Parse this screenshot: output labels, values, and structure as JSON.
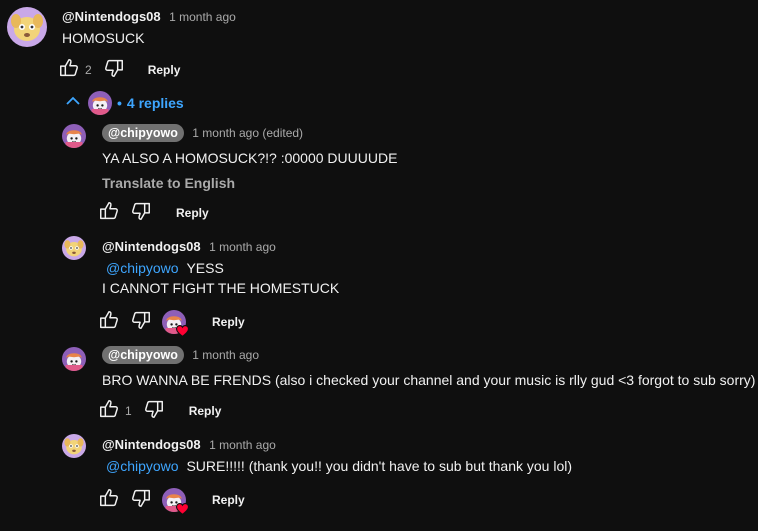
{
  "comment": {
    "author": "@Nintendogs08",
    "time": "1 month ago",
    "text": "HOMOSUCK",
    "likes": "2",
    "reply_label": "Reply"
  },
  "replies_toggle": {
    "dot": "•",
    "label": "4 replies"
  },
  "replies": [
    {
      "author": "@chipyowo",
      "time": "1 month ago (edited)",
      "text": "YA ALSO A HOMOSUCK?!? :00000 DUUUUDE",
      "translate": "Translate to English",
      "reply_label": "Reply"
    },
    {
      "author": "@Nintendogs08",
      "time": "1 month ago",
      "mention": "@chipyowo",
      "text_line1": "YESS",
      "text_line2": "I CANNOT FIGHT THE HOMESTUCK",
      "reply_label": "Reply"
    },
    {
      "author": "@chipyowo",
      "time": "1 month ago",
      "text": "BRO WANNA BE FRENDS (also i checked your channel and your music is rlly gud <3 forgot to sub sorry)",
      "likes": "1",
      "reply_label": "Reply"
    },
    {
      "author": "@Nintendogs08",
      "time": "1 month ago",
      "mention": "@chipyowo",
      "text": "SURE!!!!! (thank you!! you didn't have to sub but thank you lol)",
      "reply_label": "Reply"
    }
  ],
  "icons": {
    "like": "thumbs-up-icon",
    "dislike": "thumbs-down-icon",
    "collapse": "chevron-up-icon",
    "creator_heart": "heart-icon"
  },
  "colors": {
    "background": "#0f0f0f",
    "link": "#3ea6ff",
    "secondary_text": "#aaaaaa",
    "pill": "#717171",
    "heart": "#ff0033"
  }
}
